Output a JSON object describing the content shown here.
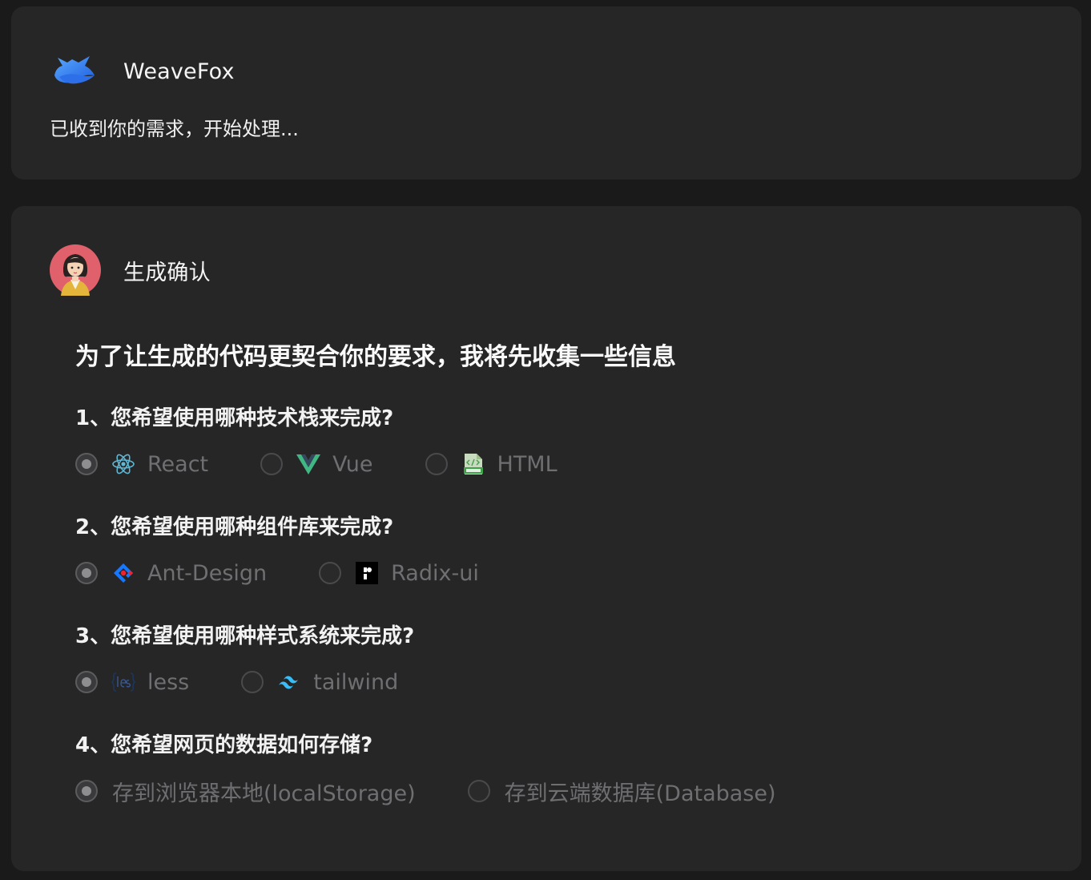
{
  "assistant": {
    "name": "WeaveFox",
    "status": "已收到你的需求，开始处理..."
  },
  "confirm": {
    "author": "生成确认",
    "title": "为了让生成的代码更契合你的要求，我将先收集一些信息",
    "questions": [
      {
        "label": "1、您希望使用哪种技术栈来完成?",
        "options": [
          {
            "label": "React",
            "icon": "react-icon",
            "selected": true
          },
          {
            "label": "Vue",
            "icon": "vue-icon",
            "selected": false
          },
          {
            "label": "HTML",
            "icon": "html-file-icon",
            "selected": false
          }
        ]
      },
      {
        "label": "2、您希望使用哪种组件库来完成?",
        "options": [
          {
            "label": "Ant-Design",
            "icon": "ant-design-icon",
            "selected": true
          },
          {
            "label": "Radix-ui",
            "icon": "radix-ui-icon",
            "selected": false
          }
        ]
      },
      {
        "label": "3、您希望使用哪种样式系统来完成?",
        "options": [
          {
            "label": "less",
            "icon": "less-icon",
            "selected": true
          },
          {
            "label": "tailwind",
            "icon": "tailwind-icon",
            "selected": false
          }
        ]
      },
      {
        "label": "4、您希望网页的数据如何存储?",
        "options": [
          {
            "label": "存到浏览器本地(localStorage)",
            "selected": true
          },
          {
            "label": "存到云端数据库(Database)",
            "selected": false
          }
        ]
      }
    ]
  },
  "colors": {
    "background": "#1a1a1b",
    "card": "#262627",
    "option_text": "#6f6f72"
  }
}
